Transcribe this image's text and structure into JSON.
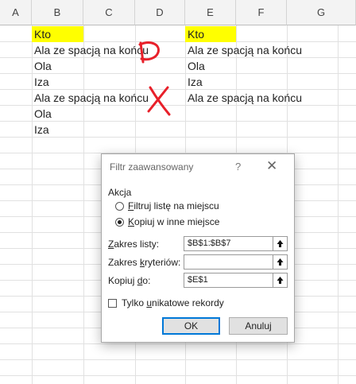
{
  "columns": [
    "A",
    "B",
    "C",
    "D",
    "E",
    "F",
    "G"
  ],
  "cells_b": [
    "Kto",
    "Ala ze spacją na końcu",
    "Ola",
    "Iza",
    "Ala ze spacją na końcu",
    "Ola",
    "Iza"
  ],
  "cells_e": [
    "Kto",
    "Ala ze spacją na końcu",
    "Ola",
    "Iza",
    "Ala ze spacją na końcu"
  ],
  "colors": {
    "highlight": "#ffff00",
    "annotation": "#e8202a",
    "default_button_border": "#0078d7"
  },
  "annotations": {
    "check_mark": "D",
    "cross_mark": "X"
  },
  "dialog": {
    "title": "Filtr zaawansowany",
    "help": "?",
    "close": "✕",
    "group_label": "Akcja",
    "radio_filter_pre": "",
    "radio_filter_key": "F",
    "radio_filter_post": "iltruj listę na miejscu",
    "radio_copy_pre": "",
    "radio_copy_key": "K",
    "radio_copy_post": "opiuj w inne miejsce",
    "selected_radio": "copy",
    "list_range_pre": "",
    "list_range_key": "Z",
    "list_range_post": "akres listy:",
    "list_range_value": "$B$1:$B$7",
    "criteria_range_pre": "Zakres ",
    "criteria_range_key": "k",
    "criteria_range_post": "ryteriów:",
    "criteria_range_value": "",
    "copy_to_pre": "Kopiuj ",
    "copy_to_key": "d",
    "copy_to_post": "o:",
    "copy_to_value": "$E$1",
    "unique_pre": "Tylko ",
    "unique_key": "u",
    "unique_post": "nikatowe rekordy",
    "unique_checked": false,
    "ok_label": "OK",
    "cancel_label": "Anuluj"
  }
}
